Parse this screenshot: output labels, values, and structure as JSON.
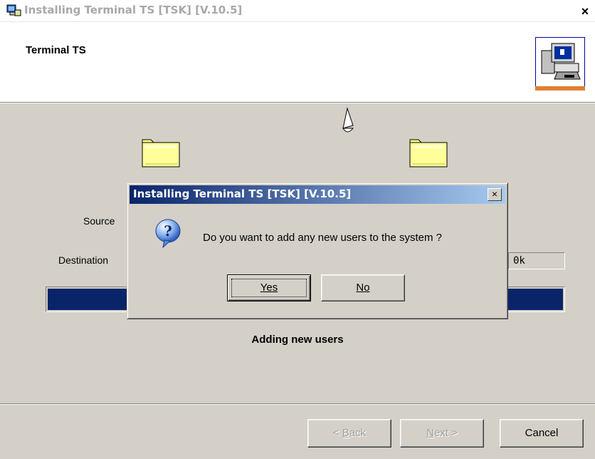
{
  "window": {
    "title": "Installing Terminal TS [TSK] [V.10.5]",
    "close_glyph": "×"
  },
  "header": {
    "title": "Terminal TS"
  },
  "labels": {
    "source": "Source",
    "destination": "Destination",
    "destination_value_suffix": "0k"
  },
  "progress": {
    "fraction": 1.0
  },
  "status": {
    "text": "Adding new users"
  },
  "footer": {
    "back_label": "< Back",
    "back_mnemonic": "B",
    "next_label": "Next >",
    "next_mnemonic": "N",
    "cancel_label": "Cancel"
  },
  "dialog": {
    "title": "Installing Terminal TS [TSK] [V.10.5]",
    "close_glyph": "×",
    "message": "Do you want to add any new  users to the system ?",
    "yes_label": "Yes",
    "no_label": "No"
  },
  "colors": {
    "progress_fill": "#0a246a",
    "dialog_title_start": "#0a246a",
    "dialog_title_end": "#a6caf0",
    "face": "#d4d0c8"
  },
  "icons": {
    "app": "installer-computer-icon",
    "dialog": "question-bubble-icon",
    "folders": "folder-icon"
  }
}
